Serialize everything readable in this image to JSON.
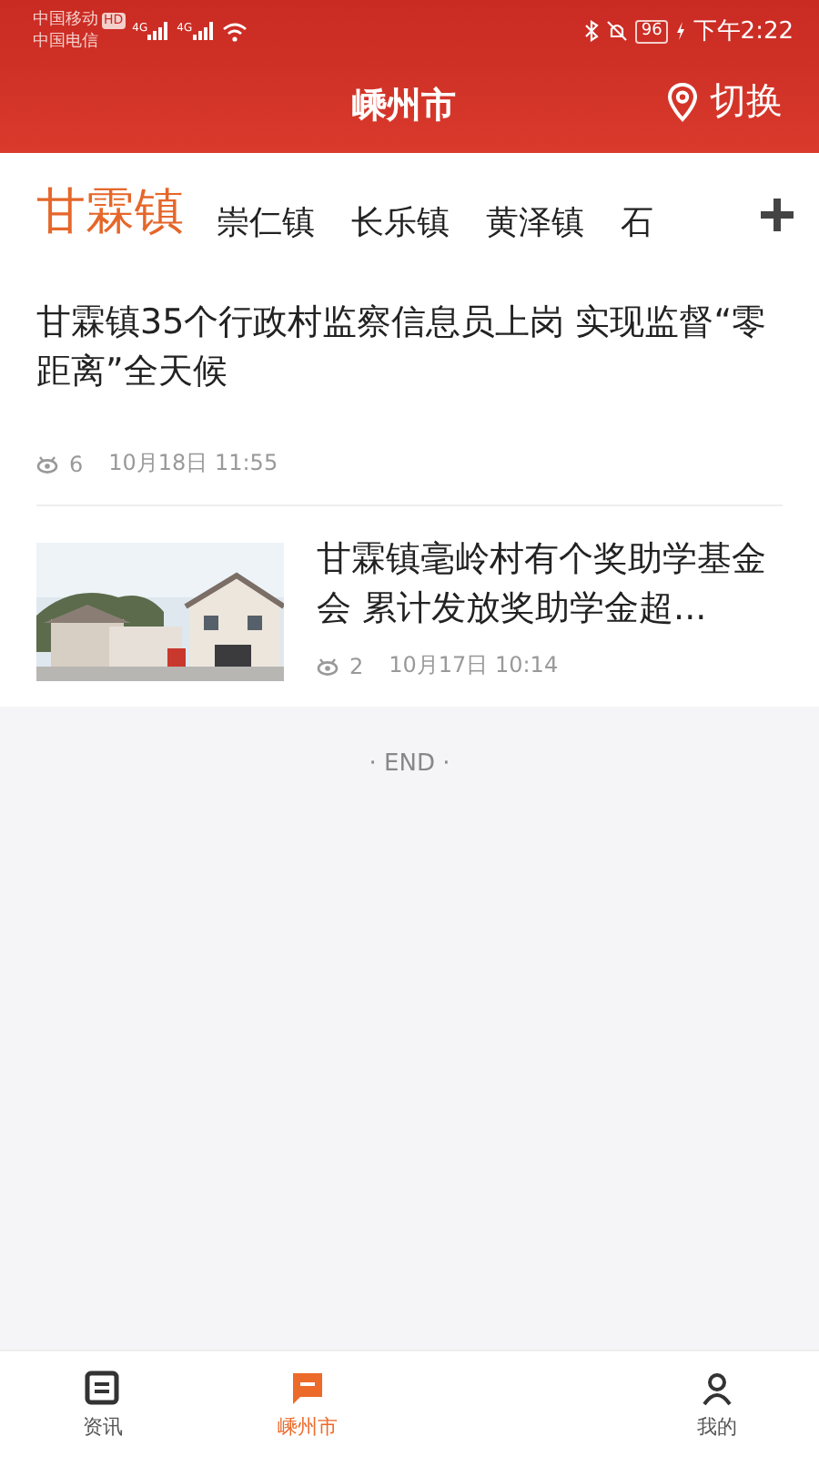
{
  "status_bar": {
    "carriers": [
      "中国移动",
      "中国电信"
    ],
    "hd": "HD",
    "networks": [
      "4G",
      "4G"
    ],
    "battery": "96",
    "time": "下午2:22"
  },
  "header": {
    "title": "嵊州市",
    "action": "切换"
  },
  "towns": [
    {
      "label": "甘霖镇",
      "selected": true
    },
    {
      "label": "崇仁镇",
      "selected": false
    },
    {
      "label": "长乐镇",
      "selected": false
    },
    {
      "label": "黄泽镇",
      "selected": false
    },
    {
      "label": "石",
      "selected": false
    }
  ],
  "news": [
    {
      "kind": "text",
      "title": "甘霖镇35个行政村监察信息员上岗 实现监督“零距离”全天候",
      "views": "6",
      "date": "10月18日 11:55"
    },
    {
      "kind": "picture",
      "title": "甘霖镇毫岭村有个奖助学基金会 累计发放奖助学金超...",
      "views": "2",
      "date": "10月17日 10:14"
    }
  ],
  "end_text": "· END ·",
  "bottom_nav": [
    {
      "label": "资讯",
      "selected": false,
      "kind": "news"
    },
    {
      "label": "嵊州市",
      "selected": true,
      "kind": "city"
    },
    {
      "kind": "hidden"
    },
    {
      "label": "我的",
      "selected": false,
      "kind": "me"
    }
  ]
}
